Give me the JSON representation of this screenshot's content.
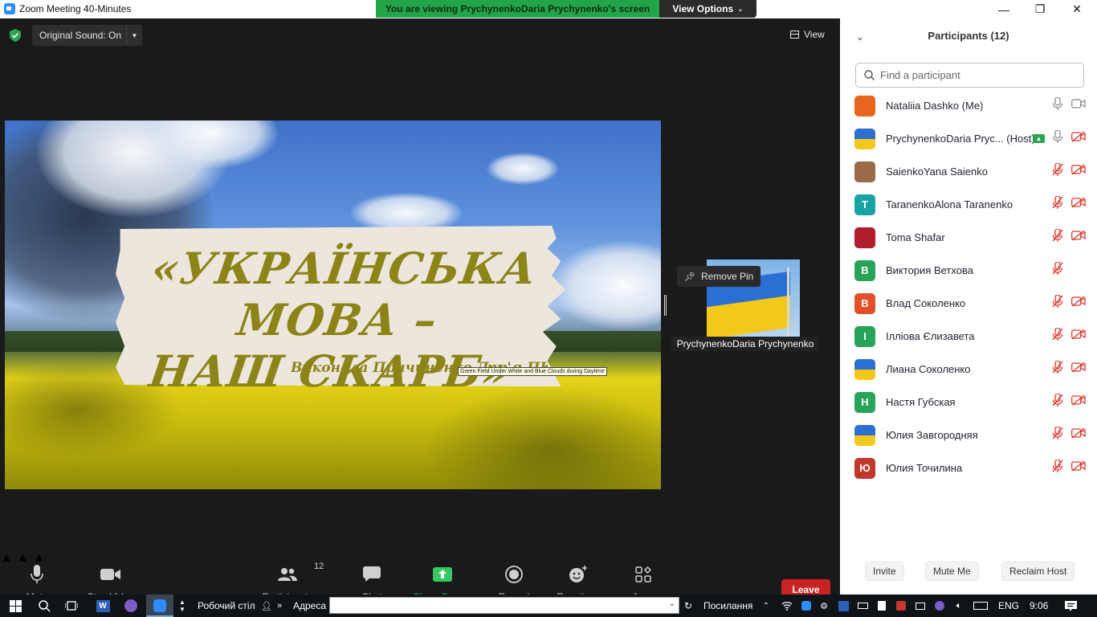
{
  "window": {
    "title": "Zoom Meeting 40-Minutes",
    "controls": {
      "minimize": "—",
      "restore": "❐",
      "close": "✕"
    }
  },
  "banner": {
    "text": "You are viewing PrychynenkoDaria Prychynenko's screen"
  },
  "view_options": {
    "label": "View Options"
  },
  "meeting_top": {
    "original_sound": "Original Sound: On",
    "view_label": "View"
  },
  "shared_screen": {
    "title_line1": "«УКРАЇНСЬКА МОВА –",
    "title_line2": "НАШ СКАРБ»",
    "subtitle": "Виконала Причиненко Дар'я ПК-",
    "tooltip": "Green Field Under White and Blue Clouds during Daytime"
  },
  "pinned_video": {
    "remove_pin": "Remove Pin",
    "name": "PrychynenkoDaria Prychynenko"
  },
  "toolbar": {
    "mute": "Mute",
    "stop_video": "Stop Video",
    "participants": "Participants",
    "participants_count": "12",
    "chat": "Chat",
    "share_screen": "Share Screen",
    "record": "Record",
    "reactions": "Reactions",
    "apps": "Apps",
    "leave": "Leave"
  },
  "panel": {
    "title": "Participants (12)",
    "search_placeholder": "Find a participant",
    "participants": [
      {
        "name": "Nataliia Dashko (Me)",
        "avatar": "",
        "avatar_color": "#e8651c",
        "mic": "on",
        "video": "on"
      },
      {
        "name": "PrychynenkoDaria Pryc... (Host)",
        "avatar": "",
        "avatar_color": "#2a6fd1",
        "mic": "on",
        "video": "off",
        "sharing": true
      },
      {
        "name": "SaienkoYana Saienko",
        "avatar": "",
        "avatar_color": "#9a6a4a",
        "mic": "off",
        "video": "off"
      },
      {
        "name": "TaranenkoAlona Taranenko",
        "avatar": "T",
        "avatar_color": "#1aa3a3",
        "mic": "off",
        "video": "off"
      },
      {
        "name": "Toma Shafar",
        "avatar": "",
        "avatar_color": "#b01e2e",
        "mic": "off",
        "video": "off"
      },
      {
        "name": "Виктория Ветхова",
        "avatar": "В",
        "avatar_color": "#27a35a",
        "mic": "off",
        "video": "none"
      },
      {
        "name": "Влад Соколенко",
        "avatar": "В",
        "avatar_color": "#e2502a",
        "mic": "off",
        "video": "off"
      },
      {
        "name": "Ілліова Єлизавета",
        "avatar": "І",
        "avatar_color": "#27a35a",
        "mic": "off",
        "video": "off"
      },
      {
        "name": "Лиана Соколенко",
        "avatar": "",
        "avatar_color": "#2a6fd1",
        "mic": "off",
        "video": "off"
      },
      {
        "name": "Настя Губская",
        "avatar": "Н",
        "avatar_color": "#27a35a",
        "mic": "off",
        "video": "off"
      },
      {
        "name": "Юлия Завгородняя",
        "avatar": "",
        "avatar_color": "#2a6fd1",
        "mic": "off",
        "video": "off"
      },
      {
        "name": "Юлия Точилина",
        "avatar": "Ю",
        "avatar_color": "#c0392b",
        "mic": "off",
        "video": "off"
      }
    ],
    "buttons": {
      "invite": "Invite",
      "mute_me": "Mute Me",
      "reclaim_host": "Reclaim Host"
    }
  },
  "taskbar": {
    "desktop": "Робочий стіл",
    "address_label": "Адреса",
    "links": "Посилання",
    "language": "ENG",
    "time": "9:06"
  }
}
